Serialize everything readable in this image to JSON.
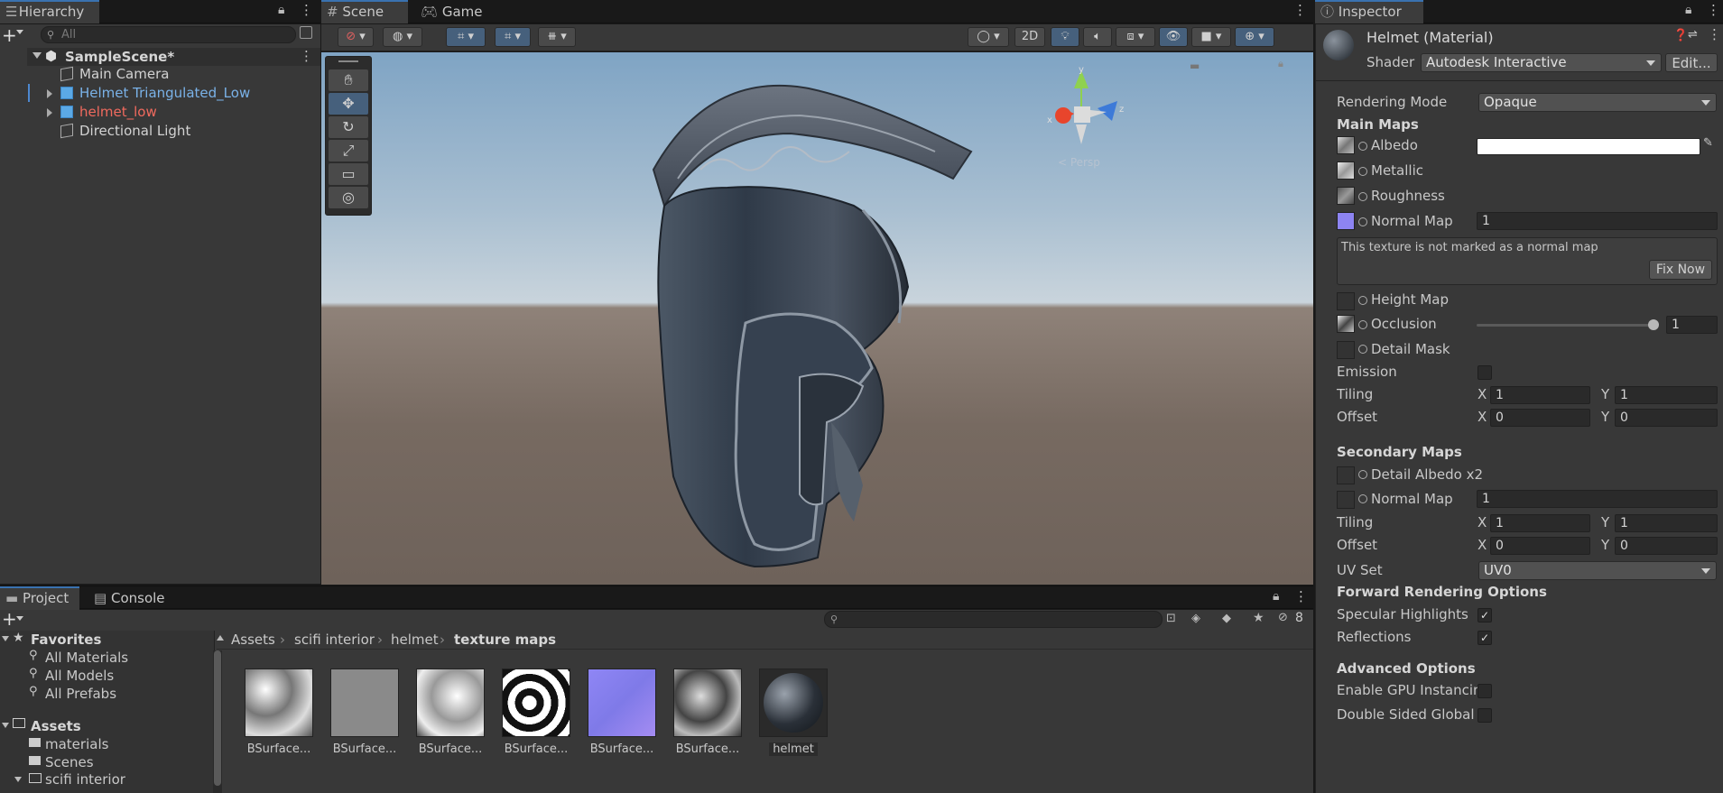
{
  "hierarchy": {
    "tab": "Hierarchy",
    "search_placeholder": "All",
    "scene": "SampleScene*",
    "items": [
      {
        "label": "Main Camera",
        "color": "#d2d2d2"
      },
      {
        "label": "Helmet Triangulated_Low",
        "color": "#7ab2e8"
      },
      {
        "label": "helmet_low",
        "color": "#f06a5e"
      },
      {
        "label": "Directional Light",
        "color": "#d2d2d2"
      }
    ]
  },
  "scene_view": {
    "tabs": [
      "Scene",
      "Game"
    ],
    "toolbar": {
      "mode_2d": "2D"
    },
    "gizmo": {
      "x": "x",
      "y": "y",
      "z": "z",
      "persp": "< Persp"
    },
    "colors": {
      "sky_top": "#7fa4c4",
      "horizon": "#c9d4dc",
      "ground": "#6e625a"
    }
  },
  "inspector": {
    "tab": "Inspector",
    "title": "Helmet (Material)",
    "shader_label": "Shader",
    "shader_value": "Autodesk Interactive",
    "edit_button": "Edit...",
    "rendering_mode_label": "Rendering Mode",
    "rendering_mode_value": "Opaque",
    "main_maps": "Main Maps",
    "albedo": "Albedo",
    "metallic": "Metallic",
    "roughness": "Roughness",
    "normal_map": "Normal Map",
    "normal_value": "1",
    "normal_warning": "This texture is not marked as a normal map",
    "fix_now": "Fix Now",
    "height_map": "Height Map",
    "occlusion": "Occlusion",
    "occlusion_value": "1",
    "detail_mask": "Detail Mask",
    "emission": "Emission",
    "tiling": "Tiling",
    "offset": "Offset",
    "x": "X",
    "y": "Y",
    "tiling_x": "1",
    "tiling_y": "1",
    "offset_x": "0",
    "offset_y": "0",
    "secondary_maps": "Secondary Maps",
    "detail_albedo": "Detail Albedo x2",
    "sec_normal_map": "Normal Map",
    "sec_normal_value": "1",
    "sec_tiling_x": "1",
    "sec_tiling_y": "1",
    "sec_offset_x": "0",
    "sec_offset_y": "0",
    "uv_set_label": "UV Set",
    "uv_set_value": "UV0",
    "forward_rendering": "Forward Rendering Options",
    "specular_highlights": "Specular Highlights",
    "reflections": "Reflections",
    "advanced_options": "Advanced Options",
    "gpu_instancing": "Enable GPU Instancin",
    "double_sided": "Double Sided Global I"
  },
  "project": {
    "tabs": [
      "Project",
      "Console"
    ],
    "hidden_count": "8",
    "favorites": "Favorites",
    "fav_items": [
      "All Materials",
      "All Models",
      "All Prefabs"
    ],
    "assets": "Assets",
    "asset_folders": [
      "materials",
      "Scenes",
      "scifi interior"
    ],
    "breadcrumb": [
      "Assets",
      "scifi interior",
      "helmet",
      "texture maps"
    ],
    "files": [
      "BSurface...",
      "BSurface...",
      "BSurface...",
      "BSurface...",
      "BSurface...",
      "BSurface...",
      "helmet"
    ]
  }
}
